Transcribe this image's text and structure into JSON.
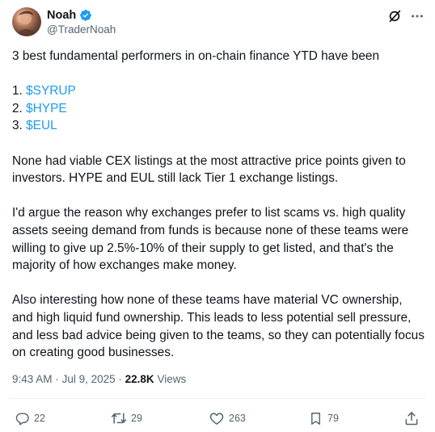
{
  "author": {
    "display_name": "Noah",
    "handle": "@TraderNoah",
    "verified": true
  },
  "tweet": {
    "intro": "3 best fundamental performers in on-chain finance YTD have been",
    "list": [
      {
        "prefix": "1. ",
        "cashtag": "$SYRUP"
      },
      {
        "prefix": "2. ",
        "cashtag": "$HYPE"
      },
      {
        "prefix": "3. ",
        "cashtag": "$EUL"
      }
    ],
    "paragraphs": [
      "None had viable CEX listings at the most attractive price points given to investors. HYPE and EUL still lack Tier 1 exchange listings.",
      "I'd argue the reason why exchanges prefer to list scams vs. high quality assets seeing demand from funds is because none of these teams were willing to give up 2.5%-10% of their supply to get listed, and that's the majority of how exchanges make money.",
      "Also interesting how none of these teams have material VC ownership, and high liquid fund ownership. This leads to less potential sell pressure, and less bad advice being given to the teams, so they can potentially focus on creating good businesses."
    ]
  },
  "meta": {
    "time": "9:43 AM",
    "separator": "·",
    "date": "Jul 9, 2025",
    "views_count": "22.8K",
    "views_label": "Views"
  },
  "actions": {
    "replies": "22",
    "reposts": "29",
    "likes": "263",
    "bookmarks": "79"
  },
  "icons": [
    "verified-badge-icon",
    "grok-icon",
    "more-options-icon",
    "reply-icon",
    "repost-icon",
    "like-icon",
    "bookmark-icon",
    "share-icon"
  ],
  "colors": {
    "accent": "#1d9bf0",
    "text": "#0f1419",
    "secondary": "#536471"
  }
}
